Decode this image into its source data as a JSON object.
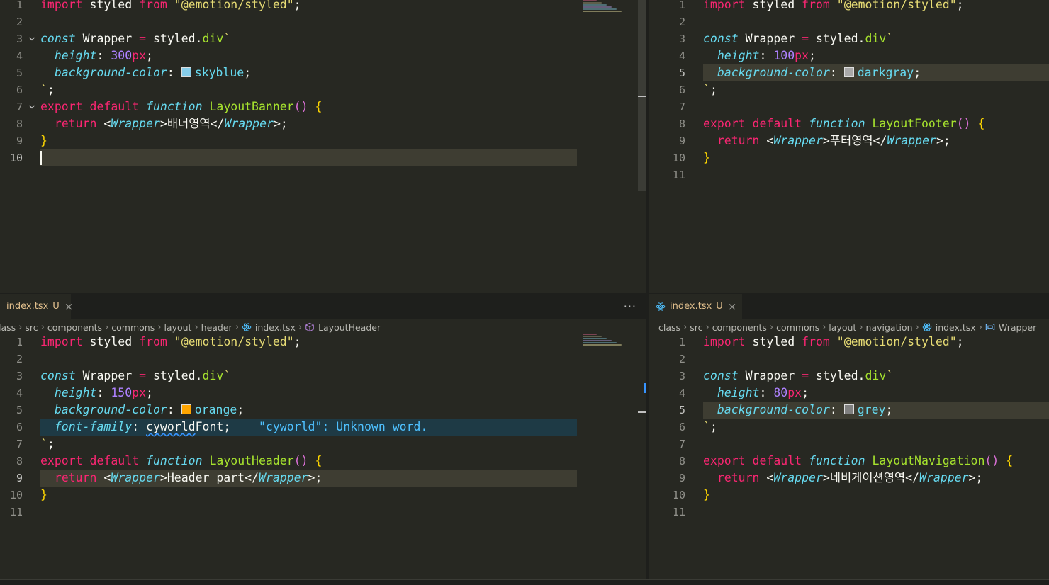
{
  "editors": {
    "top_left": {
      "lines": [
        {
          "n": "1",
          "parts": [
            {
              "t": "import",
              "c": "kw"
            },
            {
              "t": " styled ",
              "c": ""
            },
            {
              "t": "from",
              "c": "kw"
            },
            {
              "t": " ",
              "c": ""
            },
            {
              "t": "\"@emotion/styled\"",
              "c": "st"
            },
            {
              "t": ";",
              "c": ""
            }
          ]
        },
        {
          "n": "2",
          "parts": []
        },
        {
          "n": "3",
          "fold": "v",
          "parts": [
            {
              "t": "const",
              "c": "pr"
            },
            {
              "t": " Wrapper ",
              "c": ""
            },
            {
              "t": "=",
              "c": "kw"
            },
            {
              "t": " styled.",
              "c": ""
            },
            {
              "t": "div",
              "c": "fn"
            },
            {
              "t": "`",
              "c": "st"
            }
          ]
        },
        {
          "n": "4",
          "parts": [
            {
              "t": "  ",
              "c": ""
            },
            {
              "t": "height",
              "c": "pr"
            },
            {
              "t": ": ",
              "c": ""
            },
            {
              "t": "300",
              "c": "num"
            },
            {
              "t": "px",
              "c": "px"
            },
            {
              "t": ";",
              "c": ""
            }
          ]
        },
        {
          "n": "5",
          "parts": [
            {
              "t": "  ",
              "c": ""
            },
            {
              "t": "background-color",
              "c": "pr"
            },
            {
              "t": ": ",
              "c": ""
            },
            {
              "swatch": "#87ceeb"
            },
            {
              "t": "skyblue",
              "c": "val"
            },
            {
              "t": ";",
              "c": ""
            }
          ]
        },
        {
          "n": "6",
          "parts": [
            {
              "t": "`",
              "c": "st"
            },
            {
              "t": ";",
              "c": ""
            }
          ]
        },
        {
          "n": "7",
          "fold": "v",
          "parts": [
            {
              "t": "export",
              "c": "kw"
            },
            {
              "t": " ",
              "c": ""
            },
            {
              "t": "default",
              "c": "kw"
            },
            {
              "t": " ",
              "c": ""
            },
            {
              "t": "function",
              "c": "pr"
            },
            {
              "t": " ",
              "c": ""
            },
            {
              "t": "LayoutBanner",
              "c": "fn"
            },
            {
              "t": "() ",
              "c": "paren"
            },
            {
              "t": "{",
              "c": "brace"
            }
          ]
        },
        {
          "n": "8",
          "parts": [
            {
              "t": "  ",
              "c": ""
            },
            {
              "t": "return",
              "c": "kw"
            },
            {
              "t": " <",
              "c": ""
            },
            {
              "t": "Wrapper",
              "c": "tag"
            },
            {
              "t": ">배너영역</",
              "c": ""
            },
            {
              "t": "Wrapper",
              "c": "tag"
            },
            {
              "t": ">;",
              "c": ""
            }
          ]
        },
        {
          "n": "9",
          "parts": [
            {
              "t": "}",
              "c": "brace"
            }
          ]
        },
        {
          "n": "10",
          "active": true,
          "cursor": true,
          "parts": []
        }
      ]
    },
    "top_right": {
      "lines": [
        {
          "n": "1",
          "parts": [
            {
              "t": "import",
              "c": "kw"
            },
            {
              "t": " styled ",
              "c": ""
            },
            {
              "t": "from",
              "c": "kw"
            },
            {
              "t": " ",
              "c": ""
            },
            {
              "t": "\"@emotion/styled\"",
              "c": "st"
            },
            {
              "t": ";",
              "c": ""
            }
          ]
        },
        {
          "n": "2",
          "parts": []
        },
        {
          "n": "3",
          "parts": [
            {
              "t": "const",
              "c": "pr"
            },
            {
              "t": " Wrapper ",
              "c": ""
            },
            {
              "t": "=",
              "c": "kw"
            },
            {
              "t": " styled.",
              "c": ""
            },
            {
              "t": "div",
              "c": "fn"
            },
            {
              "t": "`",
              "c": "st"
            }
          ]
        },
        {
          "n": "4",
          "parts": [
            {
              "t": "  ",
              "c": ""
            },
            {
              "t": "height",
              "c": "pr"
            },
            {
              "t": ": ",
              "c": ""
            },
            {
              "t": "100",
              "c": "num"
            },
            {
              "t": "px",
              "c": "px"
            },
            {
              "t": ";",
              "c": ""
            }
          ]
        },
        {
          "n": "5",
          "active": true,
          "parts": [
            {
              "t": "  ",
              "c": ""
            },
            {
              "t": "background-color",
              "c": "pr"
            },
            {
              "t": ": ",
              "c": ""
            },
            {
              "swatch": "#a9a9a9"
            },
            {
              "t": "darkgray",
              "c": "val"
            },
            {
              "t": ";",
              "c": ""
            }
          ]
        },
        {
          "n": "6",
          "parts": [
            {
              "t": "`",
              "c": "st"
            },
            {
              "t": ";",
              "c": ""
            }
          ]
        },
        {
          "n": "7",
          "parts": []
        },
        {
          "n": "8",
          "parts": [
            {
              "t": "export",
              "c": "kw"
            },
            {
              "t": " ",
              "c": ""
            },
            {
              "t": "default",
              "c": "kw"
            },
            {
              "t": " ",
              "c": ""
            },
            {
              "t": "function",
              "c": "pr"
            },
            {
              "t": " ",
              "c": ""
            },
            {
              "t": "LayoutFooter",
              "c": "fn"
            },
            {
              "t": "() ",
              "c": "paren"
            },
            {
              "t": "{",
              "c": "brace"
            }
          ]
        },
        {
          "n": "9",
          "parts": [
            {
              "t": "  ",
              "c": ""
            },
            {
              "t": "return",
              "c": "kw"
            },
            {
              "t": " <",
              "c": ""
            },
            {
              "t": "Wrapper",
              "c": "tag"
            },
            {
              "t": ">푸터영역</",
              "c": ""
            },
            {
              "t": "Wrapper",
              "c": "tag"
            },
            {
              "t": ">;",
              "c": ""
            }
          ]
        },
        {
          "n": "10",
          "parts": [
            {
              "t": "}",
              "c": "brace"
            }
          ]
        },
        {
          "n": "11",
          "parts": []
        }
      ]
    },
    "bottom_left": {
      "tab": {
        "name": "index.tsx",
        "status": "U",
        "close": "×"
      },
      "more": "···",
      "breadcrumb": [
        "lass",
        "src",
        "components",
        "commons",
        "layout",
        "header",
        "index.tsx",
        "LayoutHeader"
      ],
      "lines": [
        {
          "n": "1",
          "parts": [
            {
              "t": "import",
              "c": "kw"
            },
            {
              "t": " styled ",
              "c": ""
            },
            {
              "t": "from",
              "c": "kw"
            },
            {
              "t": " ",
              "c": ""
            },
            {
              "t": "\"@emotion/styled\"",
              "c": "st"
            },
            {
              "t": ";",
              "c": ""
            }
          ]
        },
        {
          "n": "2",
          "parts": []
        },
        {
          "n": "3",
          "parts": [
            {
              "t": "const",
              "c": "pr"
            },
            {
              "t": " Wrapper ",
              "c": ""
            },
            {
              "t": "=",
              "c": "kw"
            },
            {
              "t": " styled.",
              "c": ""
            },
            {
              "t": "div",
              "c": "fn"
            },
            {
              "t": "`",
              "c": "st"
            }
          ]
        },
        {
          "n": "4",
          "parts": [
            {
              "t": "  ",
              "c": ""
            },
            {
              "t": "height",
              "c": "pr"
            },
            {
              "t": ": ",
              "c": ""
            },
            {
              "t": "150",
              "c": "num"
            },
            {
              "t": "px",
              "c": "px"
            },
            {
              "t": ";",
              "c": ""
            }
          ]
        },
        {
          "n": "5",
          "parts": [
            {
              "t": "  ",
              "c": ""
            },
            {
              "t": "background-color",
              "c": "pr"
            },
            {
              "t": ": ",
              "c": ""
            },
            {
              "swatch": "#ffa500"
            },
            {
              "t": "orange",
              "c": "val"
            },
            {
              "t": ";",
              "c": ""
            }
          ]
        },
        {
          "n": "6",
          "info": true,
          "parts": [
            {
              "t": "  ",
              "c": ""
            },
            {
              "t": "font-family",
              "c": "pr"
            },
            {
              "t": ": ",
              "c": ""
            },
            {
              "t": "cyworld",
              "c": "squiggle"
            },
            {
              "t": "Font;",
              "c": ""
            },
            {
              "t": "    \"cyworld\": Unknown word.",
              "c": "warn-text"
            }
          ]
        },
        {
          "n": "7",
          "parts": [
            {
              "t": "`",
              "c": "st"
            },
            {
              "t": ";",
              "c": ""
            }
          ]
        },
        {
          "n": "8",
          "parts": [
            {
              "t": "export",
              "c": "kw"
            },
            {
              "t": " ",
              "c": ""
            },
            {
              "t": "default",
              "c": "kw"
            },
            {
              "t": " ",
              "c": ""
            },
            {
              "t": "function",
              "c": "pr"
            },
            {
              "t": " ",
              "c": ""
            },
            {
              "t": "LayoutHeader",
              "c": "fn"
            },
            {
              "t": "() ",
              "c": "paren"
            },
            {
              "t": "{",
              "c": "brace"
            }
          ]
        },
        {
          "n": "9",
          "active": true,
          "parts": [
            {
              "t": "  ",
              "c": ""
            },
            {
              "t": "return",
              "c": "kw"
            },
            {
              "t": " <",
              "c": ""
            },
            {
              "t": "Wrapper",
              "c": "tag"
            },
            {
              "t": ">Header part</",
              "c": ""
            },
            {
              "t": "Wrapper",
              "c": "tag"
            },
            {
              "t": ">;",
              "c": ""
            }
          ]
        },
        {
          "n": "10",
          "parts": [
            {
              "t": "}",
              "c": "brace"
            }
          ]
        },
        {
          "n": "11",
          "parts": []
        }
      ]
    },
    "bottom_right": {
      "tab": {
        "name": "index.tsx",
        "status": "U",
        "close": "×"
      },
      "breadcrumb": [
        "class",
        "src",
        "components",
        "commons",
        "layout",
        "navigation",
        "index.tsx",
        "Wrapper"
      ],
      "lines": [
        {
          "n": "1",
          "parts": [
            {
              "t": "import",
              "c": "kw"
            },
            {
              "t": " styled ",
              "c": ""
            },
            {
              "t": "from",
              "c": "kw"
            },
            {
              "t": " ",
              "c": ""
            },
            {
              "t": "\"@emotion/styled\"",
              "c": "st"
            },
            {
              "t": ";",
              "c": ""
            }
          ]
        },
        {
          "n": "2",
          "parts": []
        },
        {
          "n": "3",
          "parts": [
            {
              "t": "const",
              "c": "pr"
            },
            {
              "t": " Wrapper ",
              "c": ""
            },
            {
              "t": "=",
              "c": "kw"
            },
            {
              "t": " styled.",
              "c": ""
            },
            {
              "t": "div",
              "c": "fn"
            },
            {
              "t": "`",
              "c": "st"
            }
          ]
        },
        {
          "n": "4",
          "parts": [
            {
              "t": "  ",
              "c": ""
            },
            {
              "t": "height",
              "c": "pr"
            },
            {
              "t": ": ",
              "c": ""
            },
            {
              "t": "80",
              "c": "num"
            },
            {
              "t": "px",
              "c": "px"
            },
            {
              "t": ";",
              "c": ""
            }
          ]
        },
        {
          "n": "5",
          "active": true,
          "parts": [
            {
              "t": "  ",
              "c": ""
            },
            {
              "t": "background-color",
              "c": "pr"
            },
            {
              "t": ": ",
              "c": ""
            },
            {
              "swatch": "#808080"
            },
            {
              "t": "grey",
              "c": "val"
            },
            {
              "t": ";",
              "c": ""
            }
          ]
        },
        {
          "n": "6",
          "parts": [
            {
              "t": "`",
              "c": "st"
            },
            {
              "t": ";",
              "c": ""
            }
          ]
        },
        {
          "n": "7",
          "parts": []
        },
        {
          "n": "8",
          "parts": [
            {
              "t": "export",
              "c": "kw"
            },
            {
              "t": " ",
              "c": ""
            },
            {
              "t": "default",
              "c": "kw"
            },
            {
              "t": " ",
              "c": ""
            },
            {
              "t": "function",
              "c": "pr"
            },
            {
              "t": " ",
              "c": ""
            },
            {
              "t": "LayoutNavigation",
              "c": "fn"
            },
            {
              "t": "() ",
              "c": "paren"
            },
            {
              "t": "{",
              "c": "brace"
            }
          ]
        },
        {
          "n": "9",
          "parts": [
            {
              "t": "  ",
              "c": ""
            },
            {
              "t": "return",
              "c": "kw"
            },
            {
              "t": " <",
              "c": ""
            },
            {
              "t": "Wrapper",
              "c": "tag"
            },
            {
              "t": ">네비게이션영역</",
              "c": ""
            },
            {
              "t": "Wrapper",
              "c": "tag"
            },
            {
              "t": ">;",
              "c": ""
            }
          ]
        },
        {
          "n": "10",
          "parts": [
            {
              "t": "}",
              "c": "brace"
            }
          ]
        },
        {
          "n": "11",
          "parts": []
        }
      ]
    }
  },
  "colors": {
    "background": "#272822",
    "keyword": "#f92672",
    "function": "#a6e22e",
    "string": "#e6db74",
    "type": "#66d9ef",
    "number": "#ae81ff"
  }
}
